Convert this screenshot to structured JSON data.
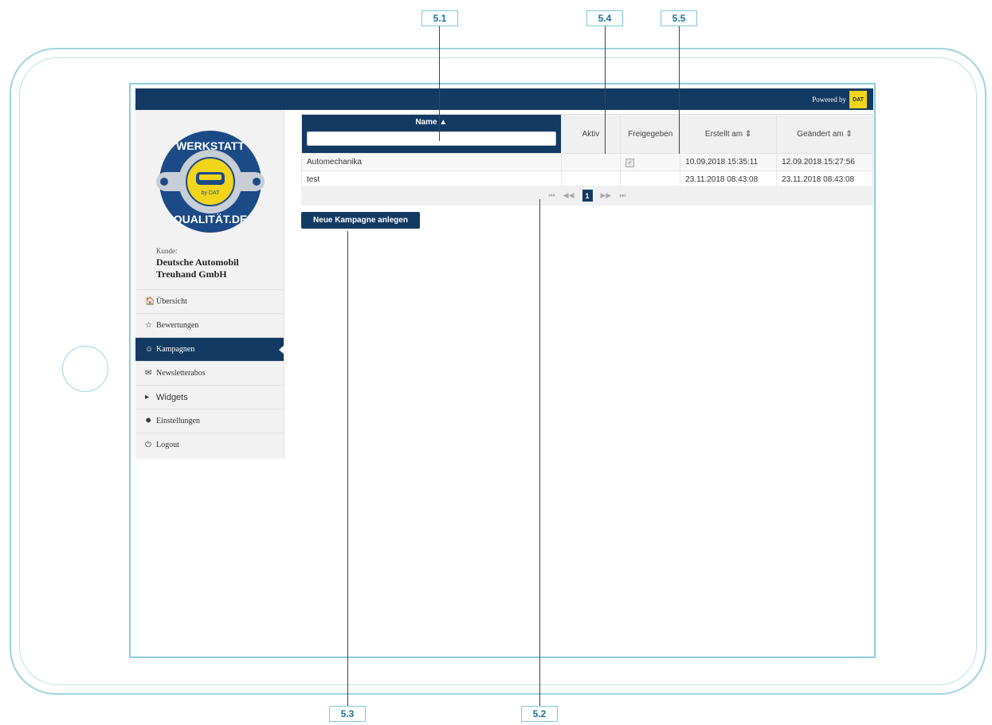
{
  "header": {
    "powered_by": "Powered by",
    "logo_text": "DAT"
  },
  "sidebar": {
    "logo": {
      "top_text": "WERKSTATT",
      "bottom_text": "QUALITÄT.DE",
      "center_text": "by DAT"
    },
    "kunde_label": "Kunde:",
    "kunde_name": "Deutsche Automobil Treuhand GmbH",
    "items": [
      {
        "label": "Übersicht",
        "icon": "home-icon",
        "glyph": "🏠"
      },
      {
        "label": "Bewertungen",
        "icon": "star-icon",
        "glyph": "☆"
      },
      {
        "label": "Kampagnen",
        "icon": "smiley-icon",
        "glyph": "☺",
        "active": true
      },
      {
        "label": "Newsletterabos",
        "icon": "envelope-icon",
        "glyph": "✉"
      },
      {
        "label": "Widgets",
        "icon": "caret-right-icon",
        "glyph": "▸"
      },
      {
        "label": "Einstellungen",
        "icon": "gear-icon",
        "glyph": "✹"
      },
      {
        "label": "Logout",
        "icon": "power-icon",
        "glyph": "⏻"
      }
    ]
  },
  "table": {
    "columns": [
      "Name",
      "Aktiv",
      "Freigegeben",
      "Erstellt am",
      "Geändert am"
    ],
    "rows": [
      {
        "name": "Automechanika",
        "aktiv": "",
        "freigegeben": true,
        "erstellt": "10.09.2018 15:35:11",
        "geaendert": "12.09.2018 15:27:56"
      },
      {
        "name": "test",
        "aktiv": "",
        "freigegeben": false,
        "erstellt": "23.11.2018 08:43:08",
        "geaendert": "23.11.2018 08:43:08"
      }
    ]
  },
  "pagination": {
    "current_page": "1"
  },
  "new_campaign_button": "Neue Kampagne anlegen",
  "callouts": [
    "5.1",
    "5.4",
    "5.5",
    "5.3",
    "5.2"
  ],
  "colors": {
    "primary": "#133a62",
    "accent": "#7fc6dc",
    "logo_yellow": "#f2d51b"
  }
}
